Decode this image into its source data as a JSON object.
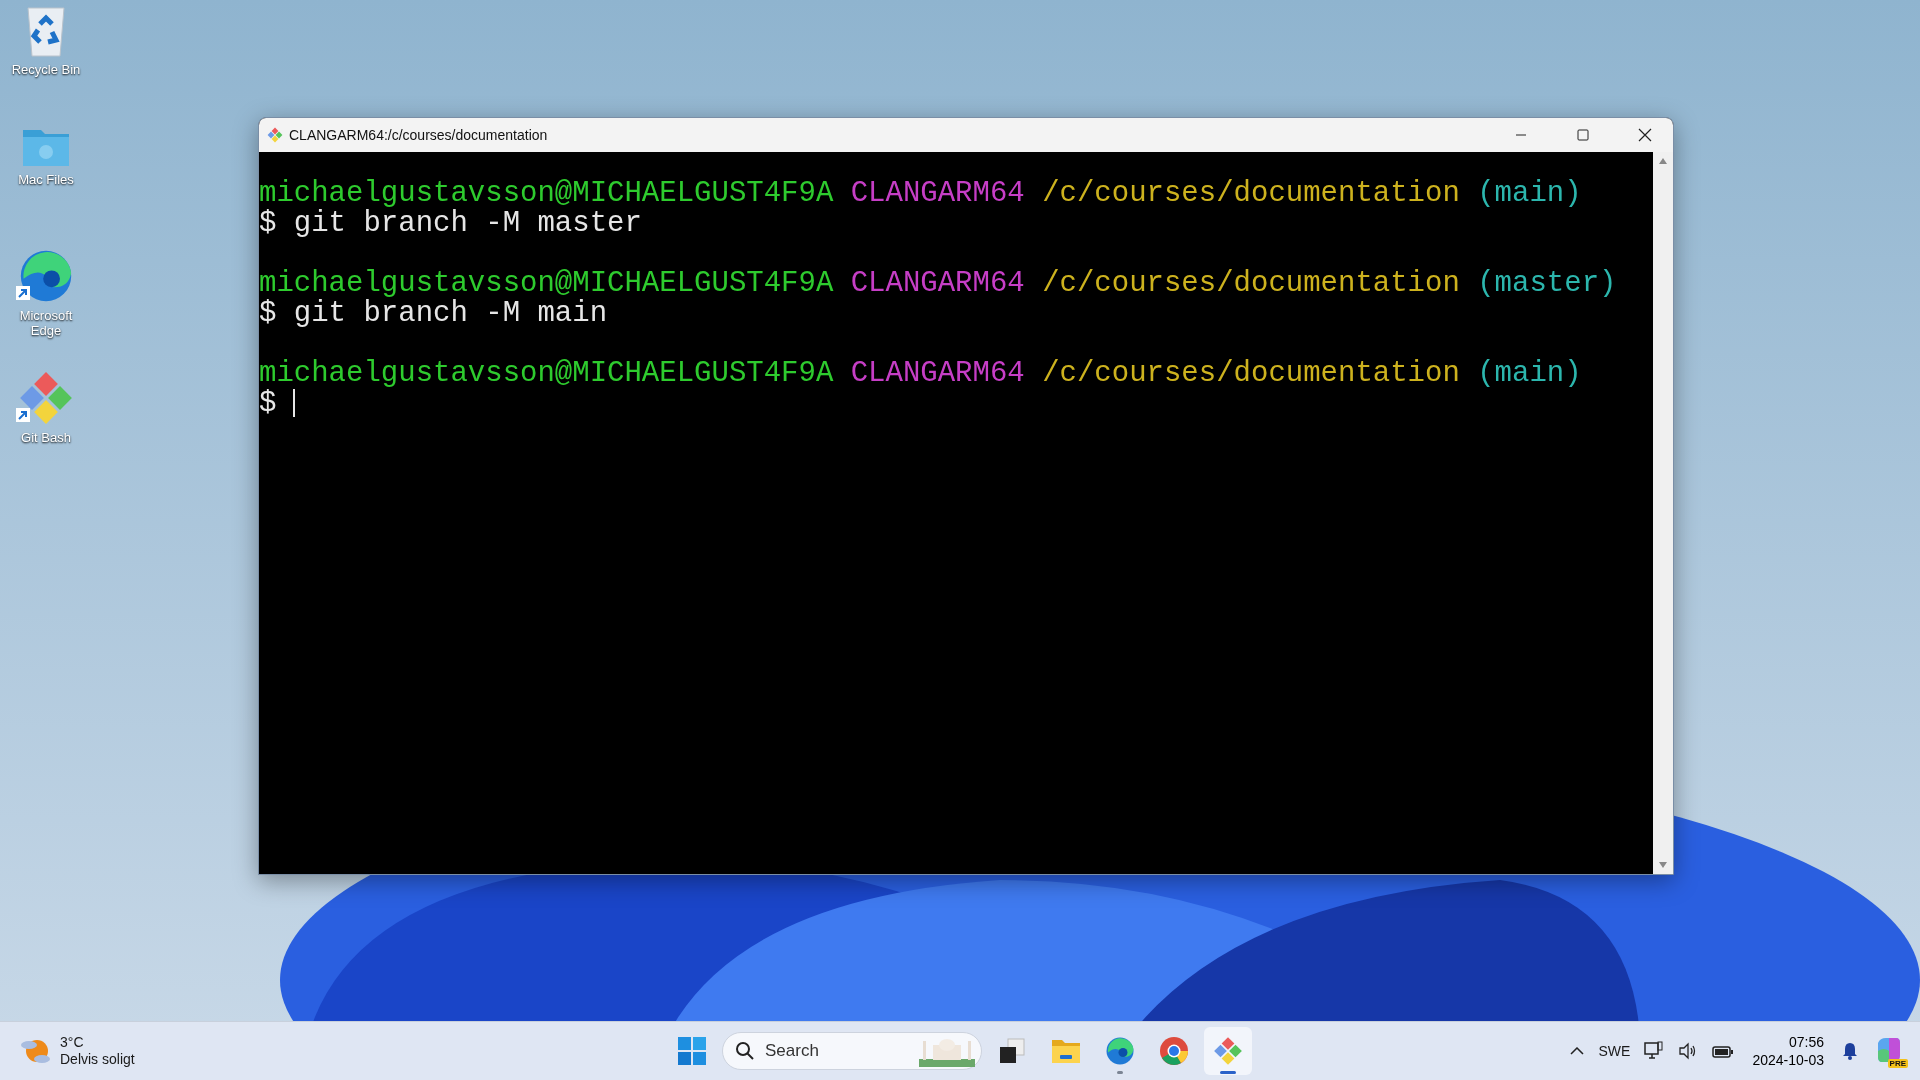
{
  "desktop_icons": [
    {
      "kind": "recycle",
      "label": "Recycle Bin",
      "shortcut": false
    },
    {
      "kind": "folder",
      "label": "Mac Files",
      "shortcut": false
    },
    {
      "kind": "edge",
      "label": "Microsoft Edge",
      "shortcut": true
    },
    {
      "kind": "git",
      "label": "Git Bash",
      "shortcut": true
    }
  ],
  "window": {
    "title": "CLANGARM64:/c/courses/documentation",
    "prompts": [
      {
        "user": "michaelgustavsson@MICHAELGUST4F9A",
        "host": "CLANGARM64",
        "path": "/c/courses/documentation",
        "branch": "(main)",
        "command": "$ git branch -M master",
        "cursor": false
      },
      {
        "user": "michaelgustavsson@MICHAELGUST4F9A",
        "host": "CLANGARM64",
        "path": "/c/courses/documentation",
        "branch": "(master)",
        "command": "$ git branch -M main",
        "cursor": false
      },
      {
        "user": "michaelgustavsson@MICHAELGUST4F9A",
        "host": "CLANGARM64",
        "path": "/c/courses/documentation",
        "branch": "(main)",
        "command": "$",
        "cursor": true
      }
    ]
  },
  "taskbar": {
    "weather": {
      "temperature": "3°C",
      "condition": "Delvis soligt"
    },
    "search": {
      "label": "Search"
    },
    "apps": [
      {
        "kind": "start",
        "running": false,
        "selected": false
      },
      {
        "kind": "taskview",
        "running": false,
        "selected": false
      },
      {
        "kind": "explorer",
        "running": false,
        "selected": false
      },
      {
        "kind": "edge",
        "running": true,
        "selected": false
      },
      {
        "kind": "chrome",
        "running": false,
        "selected": false
      },
      {
        "kind": "git",
        "running": true,
        "selected": true
      }
    ],
    "language": "SWE",
    "time": "07:56",
    "date": "2024-10-03",
    "copilot_badge": "PRE"
  }
}
